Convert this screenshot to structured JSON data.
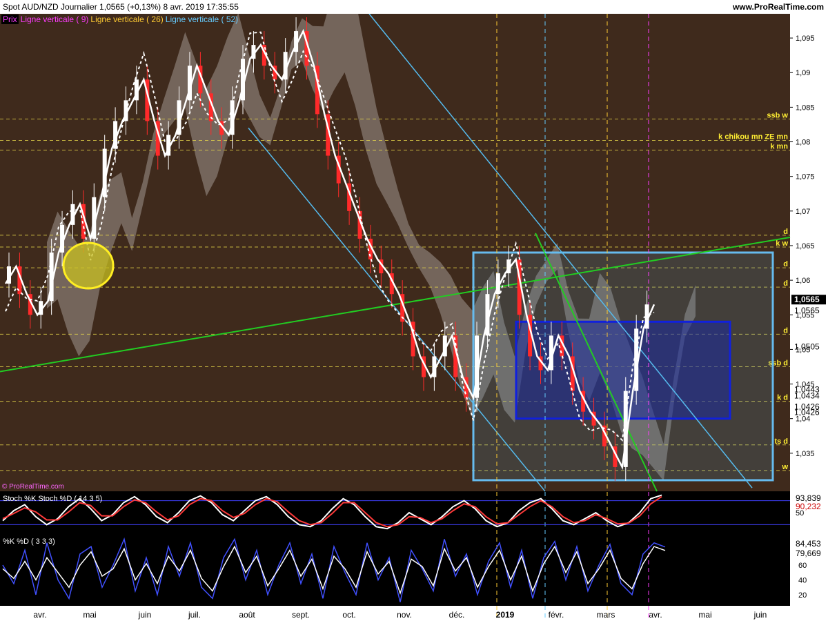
{
  "header": {
    "title": "Spot AUD/NZD   Journalier   1,0565 (+0,13%)   8 avr. 2019 17:35:55",
    "site": "www.ProRealTime.com"
  },
  "legend": {
    "prix": "Prix",
    "lv9": "Ligne verticale ( 9)",
    "lv26": "Ligne verticale ( 26)",
    "lv52": "Ligne verticale ( 52)"
  },
  "copyright": "© ProRealTime.com",
  "colors": {
    "bg_main": "#3f2a1c",
    "bg_panel": "#000000",
    "axis_bg": "#ffffff",
    "candle_up": "#ffffff",
    "candle_down": "#ff2a2a",
    "kumo": "#d8d4d0",
    "kumo_shadow": "#8a7a6c",
    "green_line": "#22cc22",
    "blue_line": "#55bbee",
    "box_light": "#66bbee",
    "box_dark": "#1020dd",
    "yellow_circle": "#ffee22",
    "stoch_k": "#ffffff",
    "stoch_d": "#ff3a3a"
  },
  "chart_data": [
    {
      "type": "line",
      "panel": "price",
      "title": "Spot AUD/NZD",
      "ylim": [
        1.0295,
        1.0985
      ],
      "y_ticks": [
        1.035,
        1.04,
        1.045,
        1.05,
        1.055,
        1.06,
        1.065,
        1.07,
        1.075,
        1.08,
        1.085,
        1.09,
        1.095
      ],
      "y_tick_labels": [
        "1,035",
        "1,04",
        "1,045",
        "1,05",
        "1,055",
        "1,06",
        "1,065",
        "1,07",
        "1,075",
        "1,08",
        "1,085",
        "1,09",
        "1,095"
      ],
      "x_months": [
        "avr.",
        "mai",
        "juin",
        "juil.",
        "août",
        "sept.",
        "oct.",
        "nov.",
        "déc.",
        "2019",
        "févr.",
        "mars",
        "avr.",
        "mai",
        "juin"
      ],
      "price_badges": [
        "1,0565",
        "1,0565",
        "1,0505",
        "1,0443",
        "1,0434",
        "1,0426",
        "1,0426"
      ],
      "level_labels": [
        {
          "label": "ssb w",
          "value": 1.0833
        },
        {
          "label": "k chikou mn ZE mn",
          "value": 1.0802
        },
        {
          "label": "k mn",
          "value": 1.0788
        },
        {
          "label": "d",
          "value": 1.0665
        },
        {
          "label": "k w",
          "value": 1.0648
        },
        {
          "label": "d",
          "value": 1.0618
        },
        {
          "label": "d",
          "value": 1.059
        },
        {
          "label": "d",
          "value": 1.0522
        },
        {
          "label": "ssb d",
          "value": 1.0475
        },
        {
          "label": "k d",
          "value": 1.0425
        },
        {
          "label": "ts d",
          "value": 1.0362
        },
        {
          "label": "w",
          "value": 1.0325
        }
      ],
      "close": [
        1.0595,
        1.062,
        1.058,
        1.055,
        1.057,
        1.064,
        1.068,
        1.071,
        1.066,
        1.072,
        1.079,
        1.083,
        1.086,
        1.089,
        1.083,
        1.078,
        1.081,
        1.086,
        1.091,
        1.087,
        1.083,
        1.081,
        1.086,
        1.092,
        1.094,
        1.091,
        1.089,
        1.093,
        1.096,
        1.091,
        1.084,
        1.078,
        1.074,
        1.07,
        1.066,
        1.063,
        1.061,
        1.058,
        1.054,
        1.049,
        1.046,
        1.049,
        1.052,
        1.046,
        1.043,
        1.052,
        1.058,
        1.061,
        1.063,
        1.055,
        1.049,
        1.047,
        1.052,
        1.049,
        1.044,
        1.041,
        1.039,
        1.036,
        1.033,
        1.044,
        1.053,
        1.0565
      ],
      "series": [
        {
          "name": "Ligne verticale ( 9)",
          "color": "#ff3cff",
          "x_index": 58
        },
        {
          "name": "Ligne verticale ( 26)",
          "color": "#ffcc33",
          "x_index": [
            48,
            54
          ]
        },
        {
          "name": "Ligne verticale ( 52)",
          "color": "#66ccff",
          "x_index": 50
        }
      ]
    },
    {
      "type": "line",
      "panel": "stoch",
      "title": "Stoch %K  Stoch %D ( 14 3 5)",
      "ylim": [
        0,
        100
      ],
      "y_tick_labels": [
        "50"
      ],
      "last_values": [
        "93,839",
        "90,232"
      ],
      "series": [
        {
          "name": "Stoch %K",
          "values": [
            30,
            55,
            70,
            40,
            20,
            35,
            65,
            85,
            60,
            30,
            45,
            75,
            90,
            70,
            40,
            25,
            50,
            80,
            92,
            75,
            45,
            30,
            55,
            80,
            90,
            70,
            40,
            20,
            15,
            30,
            60,
            85,
            70,
            40,
            15,
            10,
            25,
            50,
            35,
            20,
            40,
            65,
            80,
            60,
            30,
            15,
            25,
            55,
            75,
            85,
            60,
            30,
            20,
            35,
            50,
            30,
            15,
            25,
            50,
            85,
            93.839
          ]
        },
        {
          "name": "Stoch %D",
          "values": [
            35,
            48,
            62,
            52,
            32,
            32,
            52,
            75,
            68,
            42,
            42,
            65,
            82,
            75,
            52,
            32,
            42,
            70,
            85,
            80,
            55,
            38,
            48,
            70,
            85,
            77,
            52,
            30,
            20,
            25,
            48,
            75,
            75,
            50,
            25,
            15,
            20,
            40,
            38,
            25,
            35,
            55,
            72,
            65,
            40,
            22,
            25,
            45,
            65,
            80,
            65,
            40,
            25,
            30,
            45,
            35,
            22,
            24,
            42,
            72,
            90.232
          ]
        }
      ]
    },
    {
      "type": "line",
      "panel": "kd",
      "title": "%K  %D ( 3 3 3)",
      "ylim": [
        5,
        100
      ],
      "y_tick_labels": [
        "20",
        "40",
        "60"
      ],
      "last_values": [
        "84,453",
        "79,669"
      ],
      "series": [
        {
          "name": "%K",
          "values": [
            60,
            35,
            80,
            20,
            90,
            40,
            15,
            75,
            85,
            30,
            60,
            95,
            25,
            70,
            20,
            85,
            45,
            90,
            30,
            15,
            70,
            95,
            40,
            80,
            20,
            60,
            90,
            35,
            75,
            15,
            85,
            50,
            20,
            90,
            40,
            70,
            10,
            80,
            55,
            25,
            95,
            45,
            75,
            20,
            65,
            90,
            30,
            80,
            15,
            70,
            92,
            40,
            85,
            25,
            60,
            88,
            35,
            20,
            75,
            90,
            84.453
          ]
        },
        {
          "name": "%D",
          "values": [
            55,
            42,
            65,
            40,
            70,
            50,
            30,
            60,
            78,
            45,
            55,
            82,
            40,
            62,
            35,
            72,
            52,
            80,
            42,
            25,
            58,
            85,
            50,
            72,
            32,
            55,
            80,
            45,
            68,
            28,
            72,
            55,
            30,
            78,
            48,
            65,
            22,
            68,
            58,
            32,
            82,
            52,
            70,
            30,
            58,
            80,
            40,
            72,
            25,
            62,
            85,
            50,
            78,
            35,
            55,
            80,
            42,
            28,
            62,
            85,
            79.669
          ]
        }
      ]
    }
  ]
}
